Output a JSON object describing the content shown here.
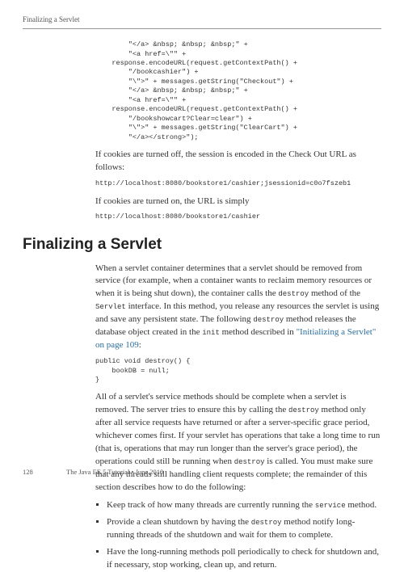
{
  "running_head": "Finalizing a Servlet",
  "code1": "        \"</a> &nbsp; &nbsp; &nbsp;\" +\n        \"<a href=\\\"\" +\n    response.encodeURL(request.getContextPath() +\n        \"/bookcashier\") +\n        \"\\\">\" + messages.getString(\"Checkout\") +\n        \"</a> &nbsp; &nbsp; &nbsp;\" +\n        \"<a href=\\\"\" +\n    response.encodeURL(request.getContextPath() +\n        \"/bookshowcart?Clear=clear\") +\n        \"\\\">\" + messages.getString(\"ClearCart\") +\n        \"</a></strong>\");",
  "p1": "If cookies are turned off, the session is encoded in the Check Out URL as follows:",
  "code2": "http://localhost:8080/bookstore1/cashier;jsessionid=c0o7fszeb1",
  "p2": "If cookies are turned on, the URL is simply",
  "code3": "http://localhost:8080/bookstore1/cashier",
  "heading": "Finalizing a Servlet",
  "p3_a": "When a servlet container determines that a servlet should be removed from service (for example, when a container wants to reclaim memory resources or when it is being shut down), the container calls the ",
  "p3_code1": "destroy",
  "p3_b": " method of the ",
  "p3_code2": "Servlet",
  "p3_c": " interface. In this method, you release any resources the servlet is using and save any persistent state. The following ",
  "p3_code3": "destroy",
  "p3_d": " method releases the database object created in the ",
  "p3_code4": "init",
  "p3_e": " method described in ",
  "p3_link": "\"Initializing a Servlet\" on page 109",
  "p3_f": ":",
  "code4": "public void destroy() {\n    bookDB = null;\n}",
  "p4_a": "All of a servlet's service methods should be complete when a servlet is removed. The server tries to ensure this by calling the ",
  "p4_code1": "destroy",
  "p4_b": " method only after all service requests have returned or after a server-specific grace period, whichever comes first. If your servlet has operations that take a long time to run (that is, operations that may run longer than the server's grace period), the operations could still be running when ",
  "p4_code2": "destroy",
  "p4_c": " is called. You must make sure that any threads still handling client requests complete; the remainder of this section describes how to do the following:",
  "bullet1_a": "Keep track of how many threads are currently running the ",
  "bullet1_code": "service",
  "bullet1_b": " method.",
  "bullet2_a": "Provide a clean shutdown by having the ",
  "bullet2_code": "destroy",
  "bullet2_b": " method notify long-running threads of the shutdown and wait for them to complete.",
  "bullet3": "Have the long-running methods poll periodically to check for shutdown and, if necessary, stop working, clean up, and return.",
  "footer_page": "128",
  "footer_text": "The Java EE 5 Tutorial  •  June 2010"
}
